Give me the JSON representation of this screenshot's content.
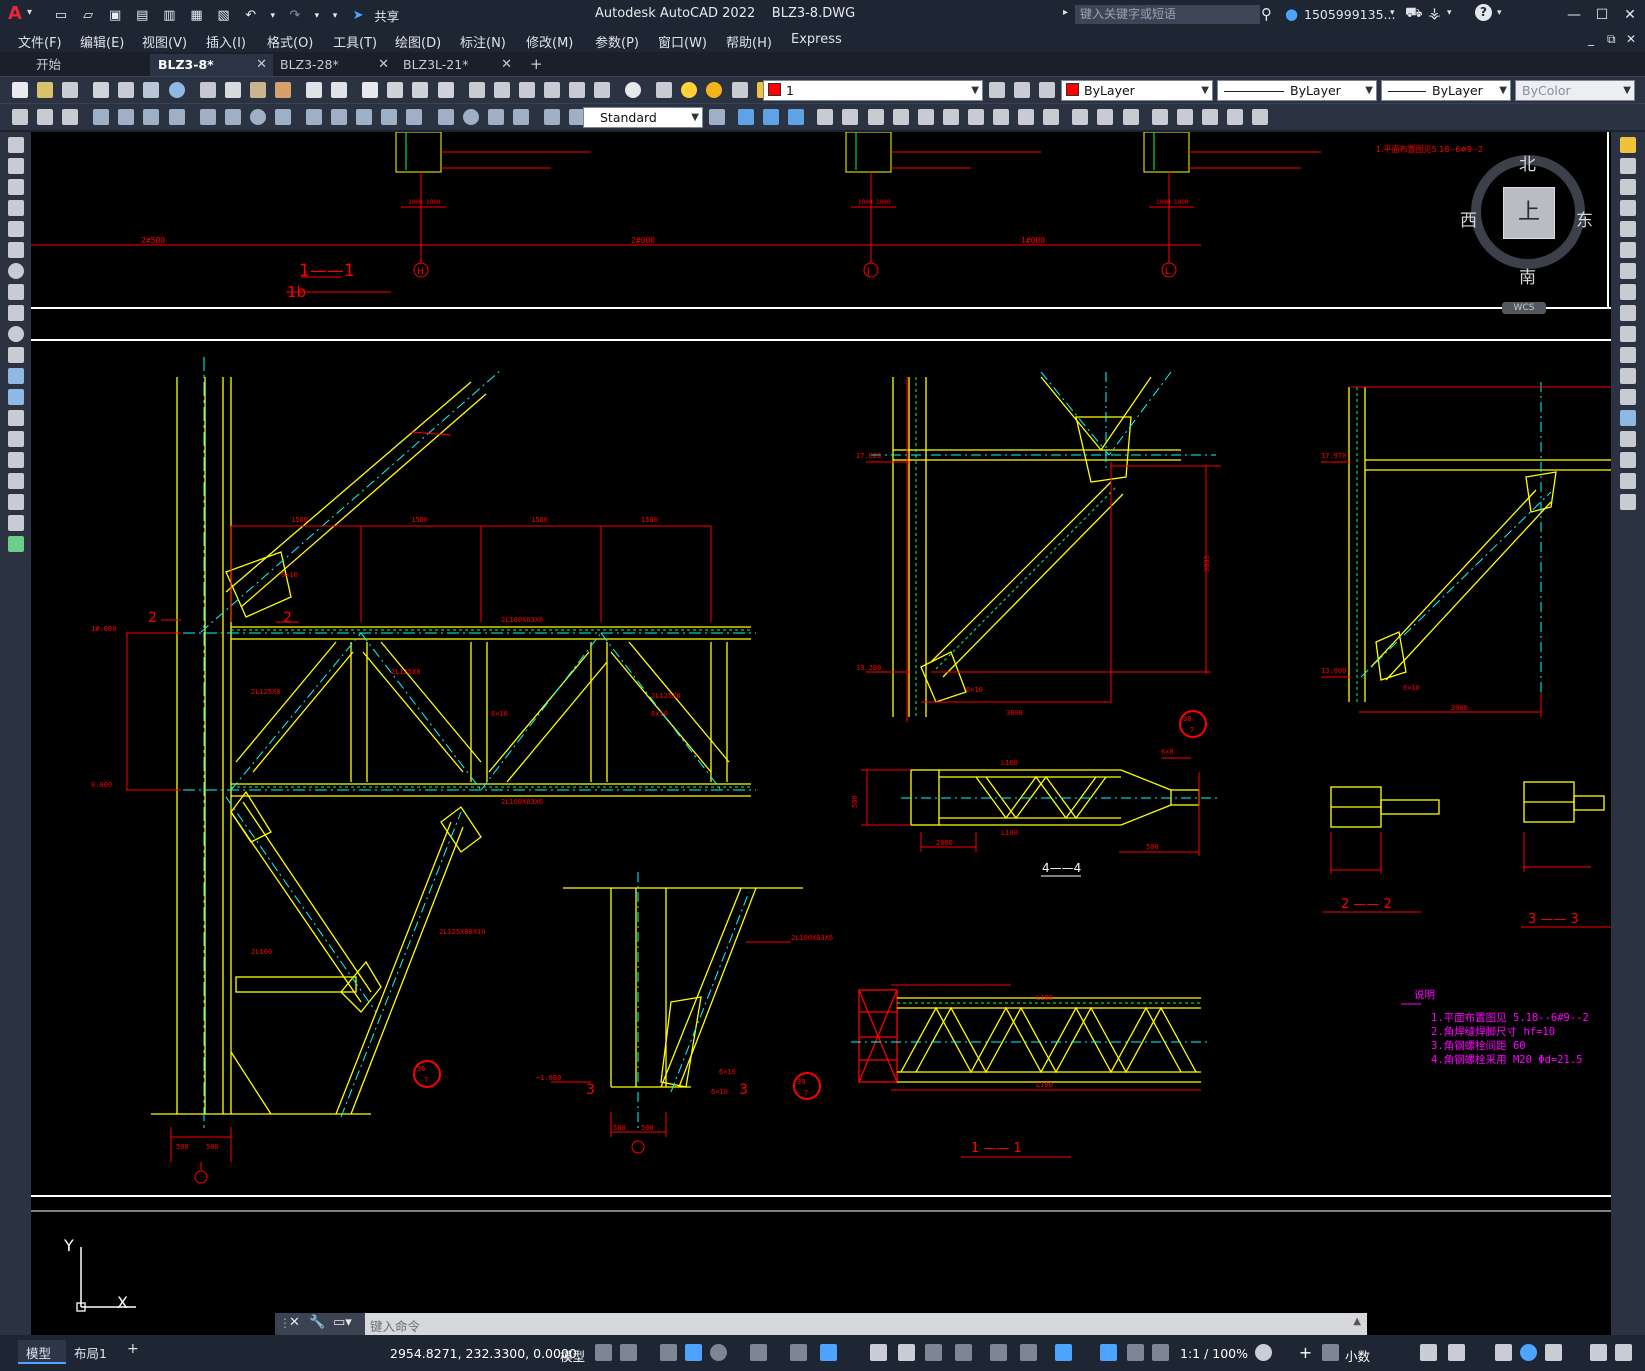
{
  "app": {
    "title": "Autodesk AutoCAD 2022",
    "file": "BLZ3-8.DWG",
    "share_label": "共享",
    "search_placeholder": "键入关键字或短语",
    "user": "1505999135...",
    "logo_letter": "A"
  },
  "menu": [
    "文件(F)",
    "编辑(E)",
    "视图(V)",
    "插入(I)",
    "格式(O)",
    "工具(T)",
    "绘图(D)",
    "标注(N)",
    "修改(M)",
    "参数(P)",
    "窗口(W)",
    "帮助(H)",
    "Express"
  ],
  "tabs": [
    {
      "label": "开始",
      "active": false,
      "closable": false
    },
    {
      "label": "BLZ3-8*",
      "active": true,
      "closable": true
    },
    {
      "label": "BLZ3-28*",
      "active": false,
      "closable": true
    },
    {
      "label": "BLZ3L-21*",
      "active": false,
      "closable": true
    }
  ],
  "new_tab_label": "+",
  "layer_bar": {
    "layer_value": "1",
    "color_value": "ByLayer",
    "linetype_value": "ByLayer",
    "lineweight_value": "ByLayer",
    "plotstyle_value": "ByColor",
    "text_style": "Standard"
  },
  "viewcube": {
    "north": "北",
    "south": "南",
    "east": "东",
    "west": "西",
    "face": "上",
    "wcs": "WCS"
  },
  "ucs": {
    "x": "X",
    "y": "Y"
  },
  "drawing": {
    "section_1_1_top": "1——1",
    "section_1b": "1b",
    "grid_h": "H",
    "grid_j": "J",
    "grid_l": "L",
    "dim_b": "1000",
    "label_2": "2",
    "label_3": "3",
    "section_4_4": "4——4",
    "section_2_2": "2 —— 2",
    "section_3_3": "3 —— 3",
    "section_1_1": "1 —— 1",
    "detail_a": "36\n7",
    "detail_c": "39\n7",
    "detail_b": "38\n7",
    "note_title": "说明",
    "notes": [
      "1.平面布置图见  5.18--6#9--2",
      "2.角焊缝焊脚尺寸  hf=10",
      "3.角钢螺栓间距  60",
      "4.角钢螺栓采用  M20 Φd=21.5"
    ],
    "top_right_note": "1.平面布置图见5.18--6#9--2"
  },
  "command": {
    "placeholder": "键入命令"
  },
  "status": {
    "model_tab": "模型",
    "layout_tab": "布局1",
    "add_tab": "+",
    "coords": "2954.8271, 232.3300, 0.0000",
    "model_label": "模型",
    "scale": "1:1 / 100%",
    "units": "小数"
  },
  "colors": {
    "accent": "#4ea3ff",
    "canvas": "#000000",
    "cad_red": "#ff0000",
    "cad_yellow": "#ffff00",
    "cad_cyan": "#00ffff"
  }
}
